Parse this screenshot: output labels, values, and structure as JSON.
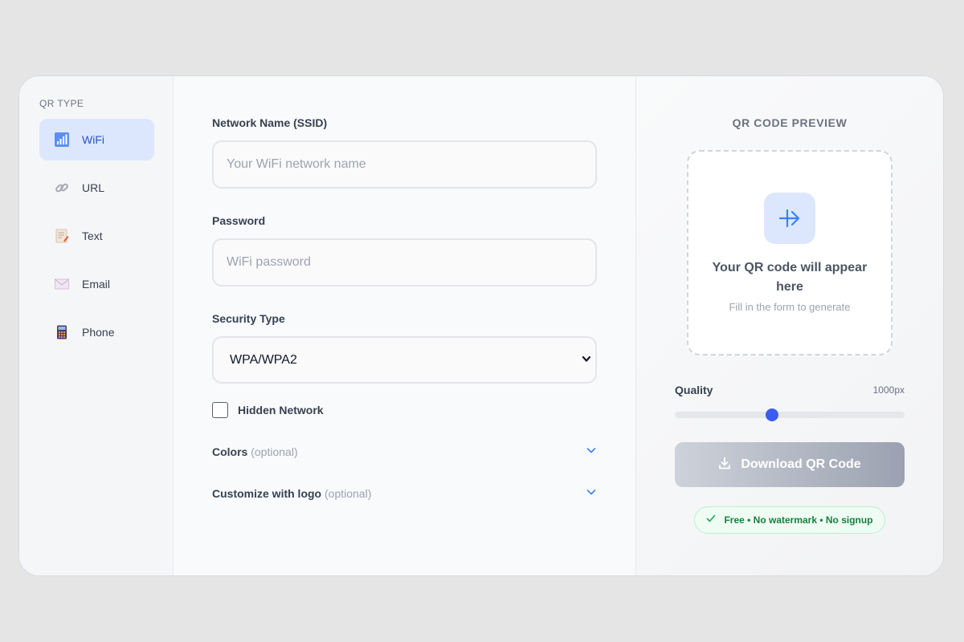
{
  "sidebar": {
    "title": "QR TYPE",
    "items": [
      {
        "label": "WiFi",
        "icon": "wifi-signal-icon",
        "active": true
      },
      {
        "label": "URL",
        "icon": "link-icon"
      },
      {
        "label": "Text",
        "icon": "document-icon"
      },
      {
        "label": "Email",
        "icon": "envelope-icon"
      },
      {
        "label": "Phone",
        "icon": "phone-icon"
      }
    ]
  },
  "form": {
    "ssid": {
      "label": "Network Name (SSID)",
      "placeholder": "Your WiFi network name",
      "value": ""
    },
    "password": {
      "label": "Password",
      "placeholder": "WiFi password",
      "value": ""
    },
    "security": {
      "label": "Security Type",
      "selected": "WPA/WPA2"
    },
    "hidden_network": {
      "label": "Hidden Network",
      "checked": false
    },
    "colors": {
      "label": "Colors",
      "optional": "(optional)"
    },
    "logo": {
      "label": "Customize with logo",
      "optional": "(optional)"
    }
  },
  "preview": {
    "title": "QR CODE PREVIEW",
    "placeholder_main": "Your QR code will appear here",
    "placeholder_sub": "Fill in the form to generate",
    "quality_label": "Quality",
    "quality_value": "1000px",
    "quality_fraction": 0.42,
    "download_label": "Download QR Code",
    "badge_text": "Free • No watermark • No signup"
  },
  "colors": {
    "accent": "#3b5cf0",
    "active_bg": "#dce7fd",
    "badge_green": "#15803d"
  }
}
